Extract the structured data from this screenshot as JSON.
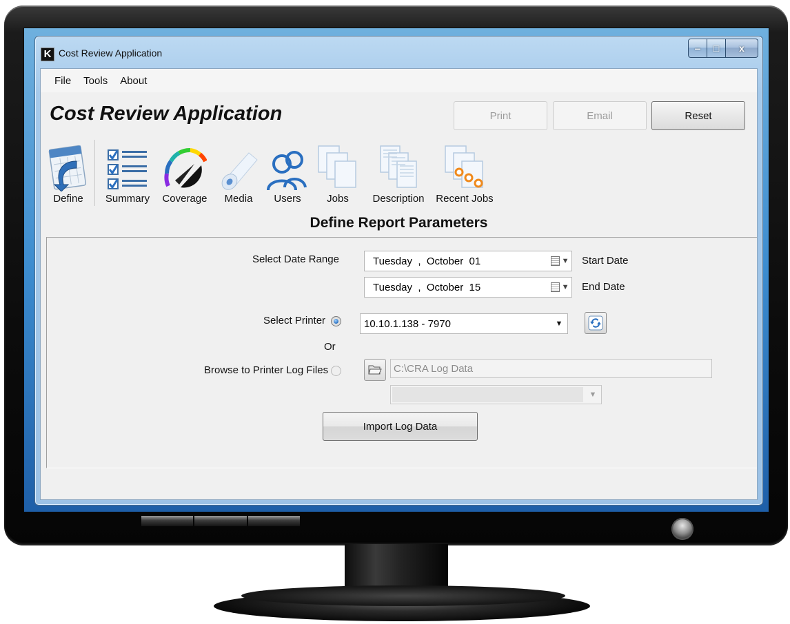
{
  "window": {
    "title": "Cost Review Application",
    "logo_letter": "K",
    "controls": {
      "minimize": "‒",
      "maximize": "□",
      "close": "x"
    }
  },
  "menu": [
    "File",
    "Tools",
    "About"
  ],
  "header": {
    "app_title": "Cost Review Application",
    "buttons": {
      "print": "Print",
      "email": "Email",
      "reset": "Reset"
    }
  },
  "toolbar": [
    {
      "label": "Define",
      "icon": "calendar-arrow-icon"
    },
    {
      "label": "Summary",
      "icon": "checklist-icon"
    },
    {
      "label": "Coverage",
      "icon": "color-wheel-gauge-icon"
    },
    {
      "label": "Media",
      "icon": "paper-roll-icon"
    },
    {
      "label": "Users",
      "icon": "users-icon"
    },
    {
      "label": "Jobs",
      "icon": "stacked-pages-icon"
    },
    {
      "label": "Description",
      "icon": "document-pages-icon"
    },
    {
      "label": "Recent Jobs",
      "icon": "recent-jobs-icon"
    }
  ],
  "section_title": "Define Report Parameters",
  "form": {
    "date_range_label": "Select Date Range",
    "start_date": {
      "day": "Tuesday",
      "sep": ",",
      "month": "October",
      "date": "01",
      "label": "Start Date"
    },
    "end_date": {
      "day": "Tuesday",
      "sep": ",",
      "month": "October",
      "date": "15",
      "label": "End Date"
    },
    "select_printer_label": "Select Printer",
    "printer_value": "10.10.1.138  -  7970",
    "or_label": "Or",
    "browse_label": "Browse to Printer Log Files",
    "log_path": "C:\\CRA Log Data",
    "log_file_value": "",
    "import_button": "Import Log Data"
  },
  "colors": {
    "accent": "#2a6fc0",
    "window_frame": "#a5c9ea",
    "client_bg": "#f0f0f0"
  }
}
